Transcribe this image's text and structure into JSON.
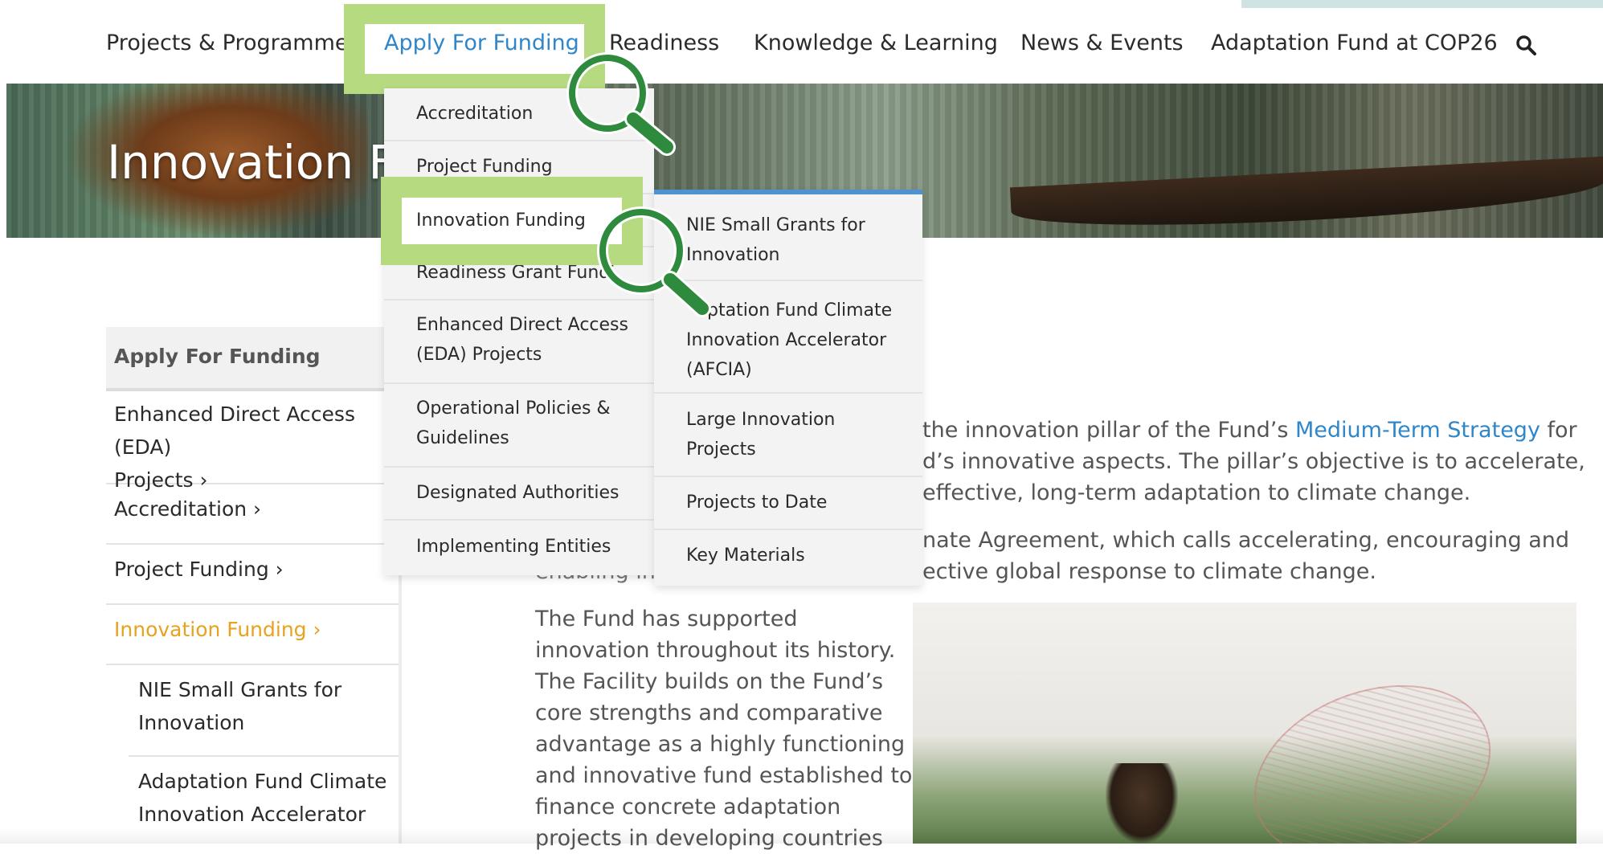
{
  "nav": {
    "items": [
      "Projects & Programmes",
      "Apply For Funding",
      "Readiness",
      "Knowledge & Learning",
      "News & Events",
      "Adaptation Fund at COP26"
    ],
    "active": "Apply For Funding",
    "search_icon": "search-icon"
  },
  "hero": {
    "title": "Innovation Fu"
  },
  "dropdown_apply": [
    "Accreditation",
    "Project Funding",
    "Innovation Funding",
    "Readiness Grant Fundi",
    "Enhanced Direct Access",
    "(EDA) Projects",
    "Operational Policies &",
    "Guidelines",
    "Designated Authorities",
    "Implementing Entities"
  ],
  "dropdown_innovation": [
    "NIE Small Grants for",
    "Innovation",
    "ptation Fund Climate",
    "Innovation Accelerator",
    "(AFCIA)",
    "Large Innovation",
    "Projects",
    "Projects to Date",
    "Key Materials"
  ],
  "sidebar": {
    "heading": "Apply For Funding",
    "items": [
      {
        "label_1": "Enhanced Direct Access (EDA)",
        "label_2": "Projects  ›"
      },
      {
        "label": "Accreditation  ›"
      },
      {
        "label": "Project Funding  ›"
      },
      {
        "label": "Innovation Funding  ›"
      }
    ],
    "sub_items": [
      {
        "label_1": "NIE Small Grants for",
        "label_2": "Innovation"
      },
      {
        "label_1": "Adaptation Fund Climate",
        "label_2": "Innovation Accelerator"
      }
    ]
  },
  "content": {
    "p1_line1_pre": "the innovation pillar of the Fund’s ",
    "p1_link": "Medium-Term Strategy",
    "p1_line1_post": " for",
    "p1_line2": "d’s innovative aspects. The pillar’s objective is to accelerate,",
    "p1_line3": "effective, long-term adaptation to climate change.",
    "p2_line1": "nate Agreement, which calls accelerating, encouraging and",
    "p2_line2": "ective global response to climate change.",
    "p2_fragment": "enabling in",
    "p3_lines": [
      "The Fund has supported",
      "innovation throughout its history.",
      "The Facility builds on the Fund’s",
      "core strengths and comparative",
      "advantage as a highly functioning",
      "and innovative fund established to",
      "finance concrete adaptation",
      "projects in developing countries"
    ]
  },
  "colors": {
    "highlight_green": "#b6da7f",
    "magnifier_green": "#2e8b3d",
    "link_blue": "#2f86c9",
    "active_orange": "#e8a21f"
  }
}
